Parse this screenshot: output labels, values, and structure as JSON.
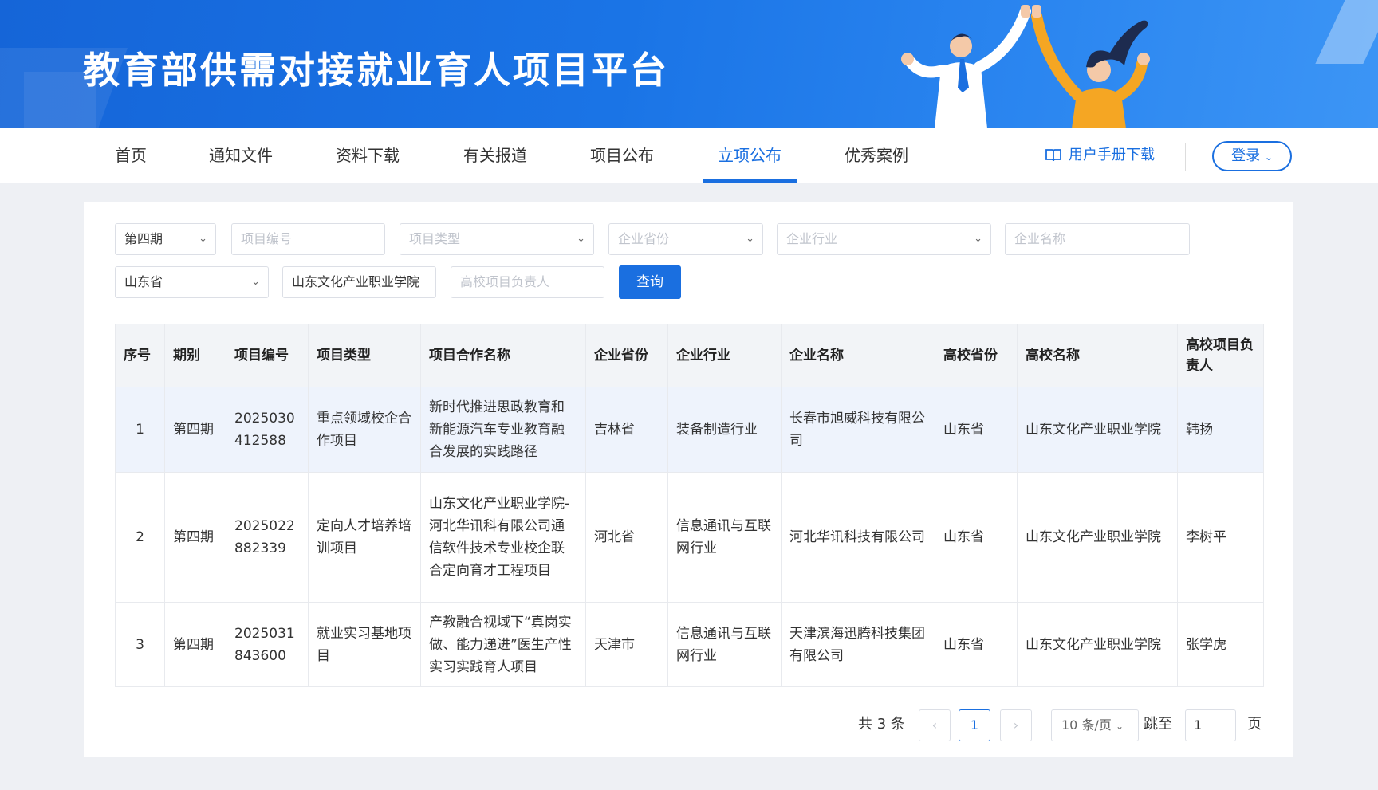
{
  "header": {
    "title": "教育部供需对接就业育人项目平台"
  },
  "nav": {
    "items": [
      "首页",
      "通知文件",
      "资料下载",
      "有关报道",
      "项目公布",
      "立项公布",
      "优秀案例"
    ],
    "active": "立项公布",
    "manual_label": "用户手册下载",
    "login_label": "登录"
  },
  "filters": {
    "period": "第四期",
    "project_no_placeholder": "项目编号",
    "project_type_placeholder": "项目类型",
    "company_province_placeholder": "企业省份",
    "company_industry_placeholder": "企业行业",
    "company_name_placeholder": "企业名称",
    "school_province": "山东省",
    "school_name": "山东文化产业职业学院",
    "leader_placeholder": "高校项目负责人",
    "query_label": "查询"
  },
  "table": {
    "headers": [
      "序号",
      "期别",
      "项目编号",
      "项目类型",
      "项目合作名称",
      "企业省份",
      "企业行业",
      "企业名称",
      "高校省份",
      "高校名称",
      "高校项目负责人"
    ],
    "rows": [
      [
        "1",
        "第四期",
        "2025030412588",
        "重点领域校企合作项目",
        "新时代推进思政教育和新能源汽车专业教育融合发展的实践路径",
        "吉林省",
        "装备制造行业",
        "长春市旭威科技有限公司",
        "山东省",
        "山东文化产业职业学院",
        "韩扬"
      ],
      [
        "2",
        "第四期",
        "2025022882339",
        "定向人才培养培训项目",
        "山东文化产业职业学院-河北华讯科有限公司通信软件技术专业校企联合定向育才工程项目",
        "河北省",
        "信息通讯与互联网行业",
        "河北华讯科技有限公司",
        "山东省",
        "山东文化产业职业学院",
        "李树平"
      ],
      [
        "3",
        "第四期",
        "2025031843600",
        "就业实习基地项目",
        "产教融合视域下“真岗实做、能力递进”医生产性实习实践育人项目",
        "天津市",
        "信息通讯与互联网行业",
        "天津滨海迅腾科技集团有限公司",
        "山东省",
        "山东文化产业职业学院",
        "张学虎"
      ]
    ]
  },
  "pagination": {
    "total_label": "共 3 条",
    "current_page": "1",
    "page_size": "10 条/页",
    "jump_label": "跳至",
    "jump_value": "1",
    "page_suffix": "页",
    "prev_icon": "chevron-left-icon",
    "next_icon": "chevron-right-icon"
  },
  "colors": {
    "primary": "#1a6fe0",
    "banner": "#1a74e6",
    "row_highlight": "#eef3fc"
  }
}
